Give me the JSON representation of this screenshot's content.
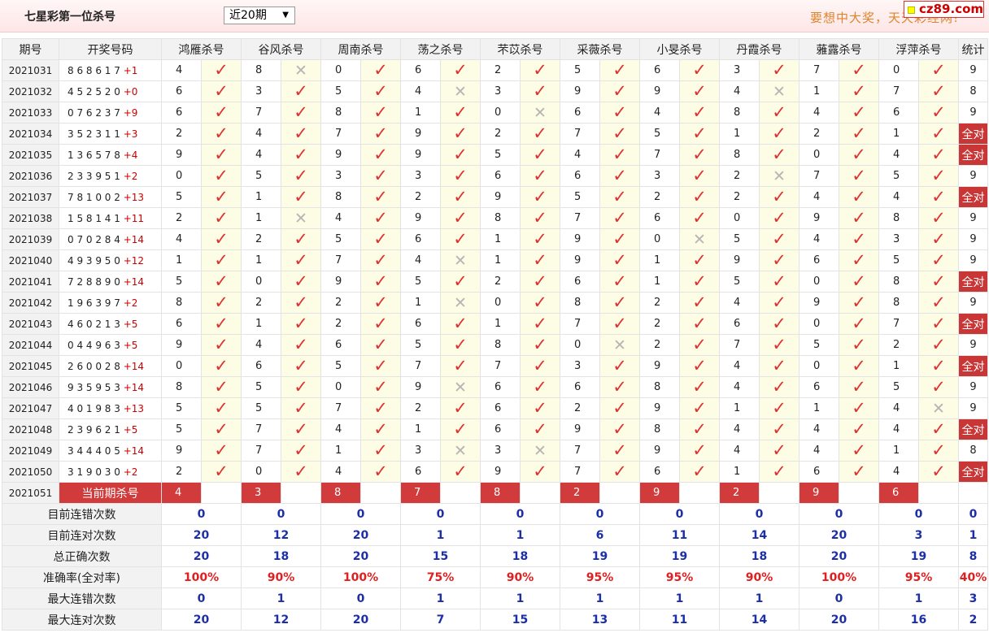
{
  "header": {
    "title": "七星彩第一位杀号",
    "select_value": "近20期",
    "slogan": "要想中大奖，天天彩经网!",
    "logo": "cz89.com"
  },
  "table": {
    "col_period": "期号",
    "col_numbers": "开奖号码",
    "col_stat": "统计",
    "experts": [
      "鸿雁杀号",
      "谷风杀号",
      "周南杀号",
      "荡之杀号",
      "芣苡杀号",
      "采薇杀号",
      "小旻杀号",
      "丹霞杀号",
      "蕥露杀号",
      "浮萍杀号"
    ],
    "all_right_text": "全对",
    "rows": [
      {
        "period": "2021031",
        "numbers": "8 6 8 6 1 7",
        "total": "+1",
        "kills": [
          "4",
          "8",
          "0",
          "6",
          "2",
          "5",
          "6",
          "3",
          "7",
          "0"
        ],
        "marks": [
          1,
          0,
          1,
          1,
          1,
          1,
          1,
          1,
          1,
          1
        ],
        "stat": "9"
      },
      {
        "period": "2021032",
        "numbers": "4 5 2 5 2 0",
        "total": "+0",
        "kills": [
          "6",
          "3",
          "5",
          "4",
          "3",
          "9",
          "9",
          "4",
          "1",
          "7"
        ],
        "marks": [
          1,
          1,
          1,
          0,
          1,
          1,
          1,
          0,
          1,
          1
        ],
        "stat": "8"
      },
      {
        "period": "2021033",
        "numbers": "0 7 6 2 3 7",
        "total": "+9",
        "kills": [
          "6",
          "7",
          "8",
          "1",
          "0",
          "6",
          "4",
          "8",
          "4",
          "6"
        ],
        "marks": [
          1,
          1,
          1,
          1,
          0,
          1,
          1,
          1,
          1,
          1
        ],
        "stat": "9"
      },
      {
        "period": "2021034",
        "numbers": "3 5 2 3 1 1",
        "total": "+3",
        "kills": [
          "2",
          "4",
          "7",
          "9",
          "2",
          "7",
          "5",
          "1",
          "2",
          "1"
        ],
        "marks": [
          1,
          1,
          1,
          1,
          1,
          1,
          1,
          1,
          1,
          1
        ],
        "stat": "全对"
      },
      {
        "period": "2021035",
        "numbers": "1 3 6 5 7 8",
        "total": "+4",
        "kills": [
          "9",
          "4",
          "9",
          "9",
          "5",
          "4",
          "7",
          "8",
          "0",
          "4"
        ],
        "marks": [
          1,
          1,
          1,
          1,
          1,
          1,
          1,
          1,
          1,
          1
        ],
        "stat": "全对"
      },
      {
        "period": "2021036",
        "numbers": "2 3 3 9 5 1",
        "total": "+2",
        "kills": [
          "0",
          "5",
          "3",
          "3",
          "6",
          "6",
          "3",
          "2",
          "7",
          "5"
        ],
        "marks": [
          1,
          1,
          1,
          1,
          1,
          1,
          1,
          0,
          1,
          1
        ],
        "stat": "9"
      },
      {
        "period": "2021037",
        "numbers": "7 8 1 0 0 2",
        "total": "+13",
        "kills": [
          "5",
          "1",
          "8",
          "2",
          "9",
          "5",
          "2",
          "2",
          "4",
          "4"
        ],
        "marks": [
          1,
          1,
          1,
          1,
          1,
          1,
          1,
          1,
          1,
          1
        ],
        "stat": "全对"
      },
      {
        "period": "2021038",
        "numbers": "1 5 8 1 4 1",
        "total": "+11",
        "kills": [
          "2",
          "1",
          "4",
          "9",
          "8",
          "7",
          "6",
          "0",
          "9",
          "8"
        ],
        "marks": [
          1,
          0,
          1,
          1,
          1,
          1,
          1,
          1,
          1,
          1
        ],
        "stat": "9"
      },
      {
        "period": "2021039",
        "numbers": "0 7 0 2 8 4",
        "total": "+14",
        "kills": [
          "4",
          "2",
          "5",
          "6",
          "1",
          "9",
          "0",
          "5",
          "4",
          "3"
        ],
        "marks": [
          1,
          1,
          1,
          1,
          1,
          1,
          0,
          1,
          1,
          1
        ],
        "stat": "9"
      },
      {
        "period": "2021040",
        "numbers": "4 9 3 9 5 0",
        "total": "+12",
        "kills": [
          "1",
          "1",
          "7",
          "4",
          "1",
          "9",
          "1",
          "9",
          "6",
          "5"
        ],
        "marks": [
          1,
          1,
          1,
          0,
          1,
          1,
          1,
          1,
          1,
          1
        ],
        "stat": "9"
      },
      {
        "period": "2021041",
        "numbers": "7 2 8 8 9 0",
        "total": "+14",
        "kills": [
          "5",
          "0",
          "9",
          "5",
          "2",
          "6",
          "1",
          "5",
          "0",
          "8"
        ],
        "marks": [
          1,
          1,
          1,
          1,
          1,
          1,
          1,
          1,
          1,
          1
        ],
        "stat": "全对"
      },
      {
        "period": "2021042",
        "numbers": "1 9 6 3 9 7",
        "total": "+2",
        "kills": [
          "8",
          "2",
          "2",
          "1",
          "0",
          "8",
          "2",
          "4",
          "9",
          "8"
        ],
        "marks": [
          1,
          1,
          1,
          0,
          1,
          1,
          1,
          1,
          1,
          1
        ],
        "stat": "9"
      },
      {
        "period": "2021043",
        "numbers": "4 6 0 2 1 3",
        "total": "+5",
        "kills": [
          "6",
          "1",
          "2",
          "6",
          "1",
          "7",
          "2",
          "6",
          "0",
          "7"
        ],
        "marks": [
          1,
          1,
          1,
          1,
          1,
          1,
          1,
          1,
          1,
          1
        ],
        "stat": "全对"
      },
      {
        "period": "2021044",
        "numbers": "0 4 4 9 6 3",
        "total": "+5",
        "kills": [
          "9",
          "4",
          "6",
          "5",
          "8",
          "0",
          "2",
          "7",
          "5",
          "2"
        ],
        "marks": [
          1,
          1,
          1,
          1,
          1,
          0,
          1,
          1,
          1,
          1
        ],
        "stat": "9"
      },
      {
        "period": "2021045",
        "numbers": "2 6 0 0 2 8",
        "total": "+14",
        "kills": [
          "0",
          "6",
          "5",
          "7",
          "7",
          "3",
          "9",
          "4",
          "0",
          "1"
        ],
        "marks": [
          1,
          1,
          1,
          1,
          1,
          1,
          1,
          1,
          1,
          1
        ],
        "stat": "全对"
      },
      {
        "period": "2021046",
        "numbers": "9 3 5 9 5 3",
        "total": "+14",
        "kills": [
          "8",
          "5",
          "0",
          "9",
          "6",
          "6",
          "8",
          "4",
          "6",
          "5"
        ],
        "marks": [
          1,
          1,
          1,
          0,
          1,
          1,
          1,
          1,
          1,
          1
        ],
        "stat": "9"
      },
      {
        "period": "2021047",
        "numbers": "4 0 1 9 8 3",
        "total": "+13",
        "kills": [
          "5",
          "5",
          "7",
          "2",
          "6",
          "2",
          "9",
          "1",
          "1",
          "4"
        ],
        "marks": [
          1,
          1,
          1,
          1,
          1,
          1,
          1,
          1,
          1,
          0
        ],
        "stat": "9"
      },
      {
        "period": "2021048",
        "numbers": "2 3 9 6 2 1",
        "total": "+5",
        "kills": [
          "5",
          "7",
          "4",
          "1",
          "6",
          "9",
          "8",
          "4",
          "4",
          "4"
        ],
        "marks": [
          1,
          1,
          1,
          1,
          1,
          1,
          1,
          1,
          1,
          1
        ],
        "stat": "全对"
      },
      {
        "period": "2021049",
        "numbers": "3 4 4 4 0 5",
        "total": "+14",
        "kills": [
          "9",
          "7",
          "1",
          "3",
          "3",
          "7",
          "9",
          "4",
          "4",
          "1"
        ],
        "marks": [
          1,
          1,
          1,
          0,
          0,
          1,
          1,
          1,
          1,
          1
        ],
        "stat": "8"
      },
      {
        "period": "2021050",
        "numbers": "3 1 9 0 3 0",
        "total": "+2",
        "kills": [
          "2",
          "0",
          "4",
          "6",
          "9",
          "7",
          "6",
          "1",
          "6",
          "4"
        ],
        "marks": [
          1,
          1,
          1,
          1,
          1,
          1,
          1,
          1,
          1,
          1
        ],
        "stat": "全对"
      }
    ],
    "current": {
      "period": "2021051",
      "label": "当前期杀号",
      "kills": [
        "4",
        "3",
        "8",
        "7",
        "8",
        "2",
        "9",
        "2",
        "9",
        "6"
      ]
    },
    "summary": [
      {
        "label": "目前连错次数",
        "values": [
          "0",
          "0",
          "0",
          "0",
          "0",
          "0",
          "0",
          "0",
          "0",
          "0"
        ],
        "stat": "0",
        "style": "sumval"
      },
      {
        "label": "目前连对次数",
        "values": [
          "20",
          "12",
          "20",
          "1",
          "1",
          "6",
          "11",
          "14",
          "20",
          "3"
        ],
        "stat": "1",
        "style": "sumval"
      },
      {
        "label": "总正确次数",
        "values": [
          "20",
          "18",
          "20",
          "15",
          "18",
          "19",
          "19",
          "18",
          "20",
          "19"
        ],
        "stat": "8",
        "style": "sumval"
      },
      {
        "label": "准确率(全对率)",
        "values": [
          "100%",
          "90%",
          "100%",
          "75%",
          "90%",
          "95%",
          "95%",
          "90%",
          "100%",
          "95%"
        ],
        "stat": "40%",
        "style": "rate"
      },
      {
        "label": "最大连错次数",
        "values": [
          "0",
          "1",
          "0",
          "1",
          "1",
          "1",
          "1",
          "1",
          "0",
          "1"
        ],
        "stat": "3",
        "style": "sumval"
      },
      {
        "label": "最大连对次数",
        "values": [
          "20",
          "12",
          "20",
          "7",
          "15",
          "13",
          "11",
          "14",
          "20",
          "16"
        ],
        "stat": "2",
        "style": "sumval"
      }
    ]
  }
}
